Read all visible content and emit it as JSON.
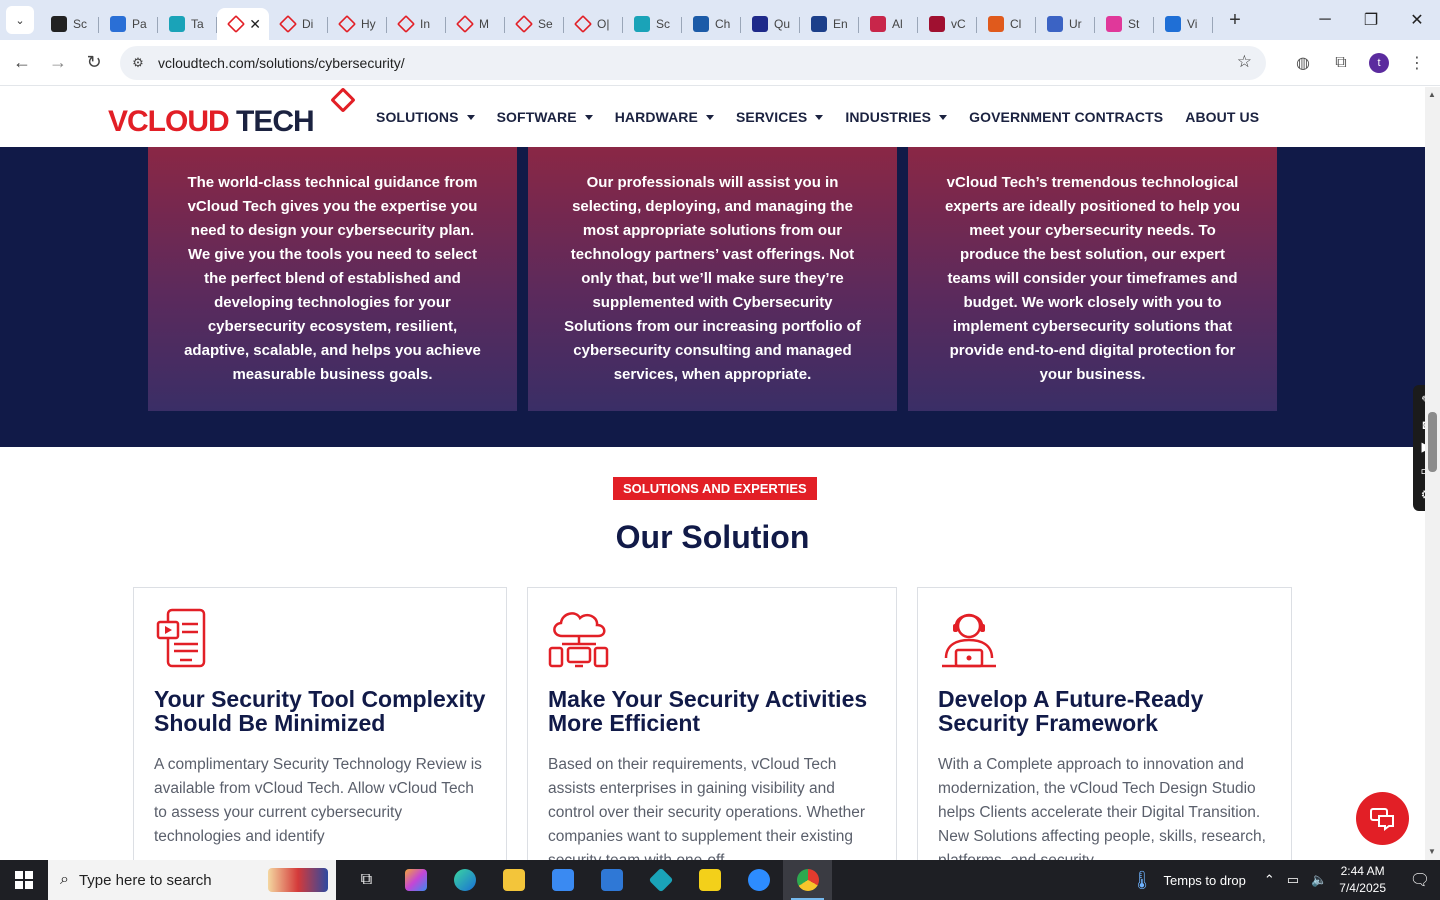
{
  "browser": {
    "tabs": [
      {
        "label": "Sc",
        "fav": "#222"
      },
      {
        "label": "Pa",
        "fav": "#2a6fd6"
      },
      {
        "label": "Ta",
        "fav": "#1aa3b8"
      },
      {
        "label": "",
        "fav": "diamond",
        "active": true
      },
      {
        "label": "Di",
        "fav": "diamond"
      },
      {
        "label": "Hy",
        "fav": "diamond"
      },
      {
        "label": "In",
        "fav": "diamond"
      },
      {
        "label": "M",
        "fav": "diamond"
      },
      {
        "label": "Se",
        "fav": "diamond"
      },
      {
        "label": "O|",
        "fav": "diamond"
      },
      {
        "label": "Sc",
        "fav": "#1aa3b8"
      },
      {
        "label": "Ch",
        "fav": "#1c5ba8"
      },
      {
        "label": "Qu",
        "fav": "#1f2a8a"
      },
      {
        "label": "En",
        "fav": "#1c3f8a"
      },
      {
        "label": "Al",
        "fav": "#c8264a"
      },
      {
        "label": "vC",
        "fav": "#a01030"
      },
      {
        "label": "Cl",
        "fav": "#e05a1c"
      },
      {
        "label": "Ur",
        "fav": "#3b63c4"
      },
      {
        "label": "St",
        "fav": "#e0389a"
      },
      {
        "label": "Vi",
        "fav": "#1f6fd6"
      }
    ],
    "active_tab_close": "✕",
    "new_tab": "+",
    "url": "vcloudtech.com/solutions/cybersecurity/",
    "profile_initial": "t"
  },
  "header": {
    "logo_left": "VCLOUD",
    "logo_right": " TECH",
    "nav": [
      {
        "label": "SOLUTIONS",
        "has_caret": true
      },
      {
        "label": "SOFTWARE",
        "has_caret": true
      },
      {
        "label": "HARDWARE",
        "has_caret": true
      },
      {
        "label": "SERVICES",
        "has_caret": true
      },
      {
        "label": "INDUSTRIES",
        "has_caret": true
      },
      {
        "label": "GOVERNMENT CONTRACTS",
        "has_caret": false
      },
      {
        "label": "ABOUT US",
        "has_caret": false
      }
    ]
  },
  "feature_cards": [
    {
      "text": "The world-class technical guidance from vCloud Tech gives you the expertise you need to design your cybersecurity plan. We give you the tools you need to select the perfect blend of established and developing technologies for your cybersecurity ecosystem, resilient, adaptive, scalable, and helps you achieve measurable business goals."
    },
    {
      "text": "Our professionals will assist you in selecting, deploying, and managing the most appropriate solutions from our technology partners’ vast offerings. Not only that, but we’ll make sure they’re supplemented with Cybersecurity Solutions from our increasing portfolio of cybersecurity consulting and managed services, when appropriate."
    },
    {
      "text": "vCloud Tech’s tremendous technological experts are ideally positioned to help you meet your cybersecurity needs. To produce the best solution, our expert teams will consider your timeframes and budget. We work closely with you to implement cybersecurity solutions that provide end-to-end digital protection for your business."
    }
  ],
  "solutions": {
    "badge": "SOLUTIONS AND EXPERTIES",
    "title": "Our Solution",
    "cards": [
      {
        "icon": "tablet-document-icon",
        "title": "Your Security Tool Complexity Should Be Minimized",
        "text": "A complimentary Security Technology Review is available from vCloud Tech. Allow vCloud Tech to assess your current cybersecurity technologies and identify"
      },
      {
        "icon": "cloud-devices-icon",
        "title": "Make Your Security Activities More Efficient",
        "text": "Based on their requirements, vCloud Tech assists enterprises in gaining visibility and control over their security operations. Whether companies want to supplement their existing security team with one-off"
      },
      {
        "icon": "support-agent-icon",
        "title": "Develop A Future-Ready Security Framework",
        "text": "With a Complete approach to innovation and modernization, the vCloud Tech Design Studio helps Clients accelerate their Digital Transition. New Solutions affecting people, skills, research, platforms, and security"
      }
    ]
  },
  "taskbar": {
    "search_placeholder": "Type here to search",
    "weather": "Temps to drop",
    "time": "2:44 AM",
    "date": "7/4/2025"
  },
  "colors": {
    "accent": "#e21f26",
    "navy": "#111a48"
  }
}
